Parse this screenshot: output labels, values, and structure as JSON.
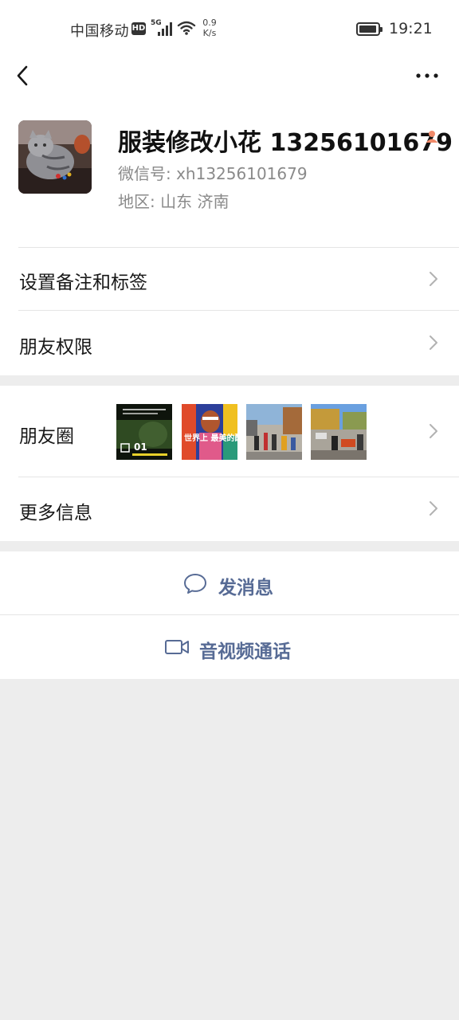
{
  "status_bar": {
    "carrier": "中国移动",
    "hd": "HD",
    "network": "5G",
    "speed_value": "0.9",
    "speed_unit": "K/s",
    "time": "19:21"
  },
  "profile": {
    "name": "服装修改小花 13256101679",
    "wechat_id": "微信号: xh13256101679",
    "region": "地区: 山东  济南"
  },
  "rows": {
    "remark_tags": "设置备注和标签",
    "friend_permissions": "朋友权限",
    "moments": "朋友圈",
    "more_info": "更多信息"
  },
  "moments_thumbs": [
    {
      "caption": "01",
      "kind": "dark-poster"
    },
    {
      "caption": "世界上 最美的配色",
      "kind": "colorful-poster"
    },
    {
      "caption": "",
      "kind": "street-photo"
    },
    {
      "caption": "",
      "kind": "street-photo"
    }
  ],
  "actions": {
    "send_message": "发消息",
    "video_call": "音视频通话"
  },
  "colors": {
    "link_blue": "#576b95",
    "background": "#ededed",
    "card": "#ffffff"
  }
}
